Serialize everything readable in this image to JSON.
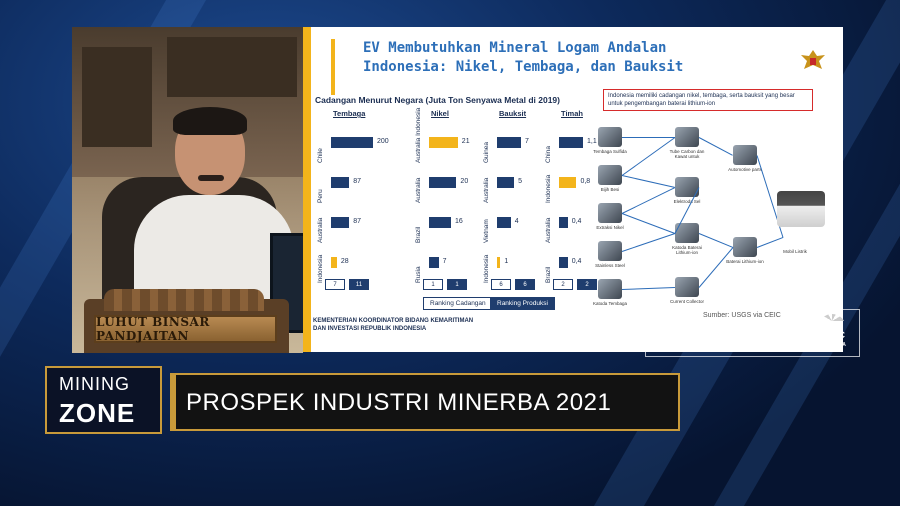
{
  "presenter": {
    "nameplate": "LUHUT BINSAR PANDJAITAN"
  },
  "slide": {
    "title_line1": "EV Membutuhkan Mineral Logam Andalan",
    "title_line2": "Indonesia: Nikel, Tembaga, dan Bauksit",
    "chart_caption": "Cadangan Menurut Negara (Juta Ton Senyawa Metal di 2019)",
    "note": "Indonesia memiliki cadangan nikel, tembaga, serta bauksit yang besar untuk pengembangan baterai lithium-ion",
    "legend_reserve": "Ranking Cadangan",
    "legend_production": "Ranking Produksi",
    "footer_line1": "KEMENTERIAN KOORDINATOR BIDANG KEMARITIMAN",
    "footer_line2": "DAN INVESTASI REPUBLIK INDONESIA",
    "source": "Sumber: USGS via CEIC"
  },
  "chart_data": [
    {
      "type": "bar",
      "title": "Tembaga",
      "categories": [
        "Chile",
        "Peru",
        "Australia",
        "Indonesia"
      ],
      "values": [
        200,
        87,
        87,
        28
      ],
      "highlight": "Indonesia",
      "ranks": [
        "7",
        "11"
      ]
    },
    {
      "type": "bar",
      "title": "Nikel",
      "categories": [
        "Australia Indonesia",
        "Australia",
        "Brazil",
        "Rusia"
      ],
      "values": [
        21,
        20,
        16,
        7
      ],
      "highlight": "Australia Indonesia",
      "ranks": [
        "1",
        "1"
      ]
    },
    {
      "type": "bar",
      "title": "Bauksit",
      "categories": [
        "Guinea",
        "Australia",
        "Vietnam",
        "Indonesia"
      ],
      "values": [
        7,
        5,
        4,
        1
      ],
      "highlight": "Indonesia",
      "ranks": [
        "6",
        "6"
      ]
    },
    {
      "type": "bar",
      "title": "Timah",
      "categories": [
        "China",
        "Indonesia",
        "Australia",
        "Brazil"
      ],
      "values": [
        1.1,
        0.8,
        0.4,
        0.4
      ],
      "value_labels": [
        "1,1",
        "0,8",
        "0,4",
        "0,4"
      ],
      "highlight": "Indonesia",
      "ranks": [
        "2",
        "2"
      ]
    }
  ],
  "flow": {
    "labels": [
      "Tembaga Sulfida",
      "Bijih Besi",
      "Extraksi Nikel",
      "Stainless Steel",
      "Katoda Tembaga",
      "Tube Carbon dan Kawat untuk",
      "Automotive parts",
      "Elektroda Sel",
      "Katoda Baterai Lithium-ion",
      "Baterai Lithium-ion",
      "Current Collector",
      "Mobil Listrik"
    ]
  },
  "watermark": {
    "text": "PROPERTY OF",
    "brand": "CNBC",
    "brand_sub": "INDONESIA"
  },
  "lower_third": {
    "segment_top": "MINING",
    "segment_bottom": "ZONE",
    "headline": "PROSPEK INDUSTRI MINERBA 2021"
  },
  "colors": {
    "accent_gold": "#c89a3a",
    "slide_yellow": "#f3b41b",
    "bar_navy": "#1f3d6e",
    "title_blue": "#2d6fb8"
  }
}
